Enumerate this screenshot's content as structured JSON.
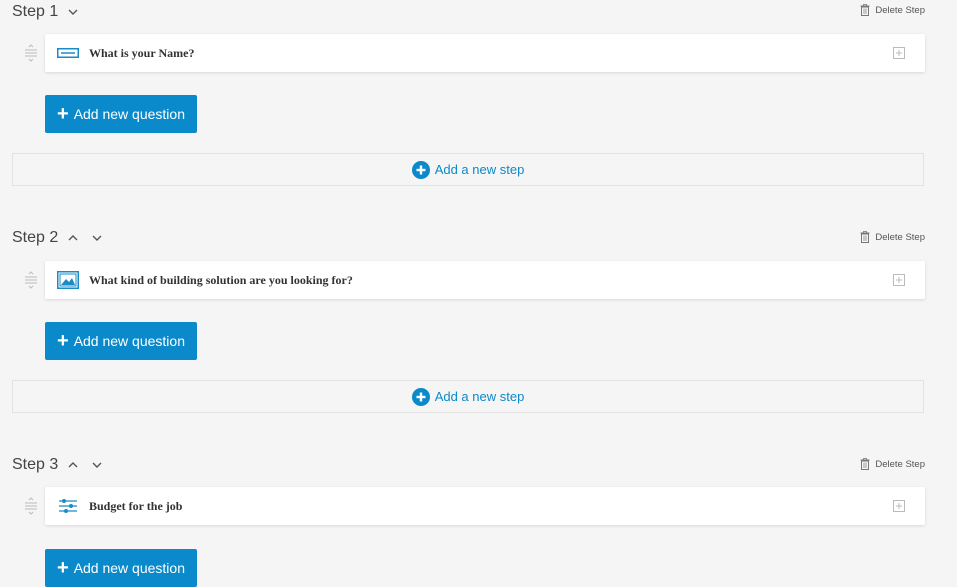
{
  "steps": [
    {
      "title": "Step 1",
      "delete_label": "Delete Step",
      "question": "What is your Name?",
      "question_icon": "text-field-icon",
      "add_question_label": "Add new question",
      "add_step_label": "Add a new step"
    },
    {
      "title": "Step 2",
      "delete_label": "Delete Step",
      "question": "What kind of building solution are you looking for?",
      "question_icon": "image-choice-icon",
      "add_question_label": "Add new question",
      "add_step_label": "Add a new step"
    },
    {
      "title": "Step 3",
      "delete_label": "Delete Step",
      "question": "Budget for the job",
      "question_icon": "slider-icon",
      "add_question_label": "Add new question"
    }
  ],
  "colors": {
    "accent": "#0a8acb",
    "background": "#f5f5f5"
  }
}
